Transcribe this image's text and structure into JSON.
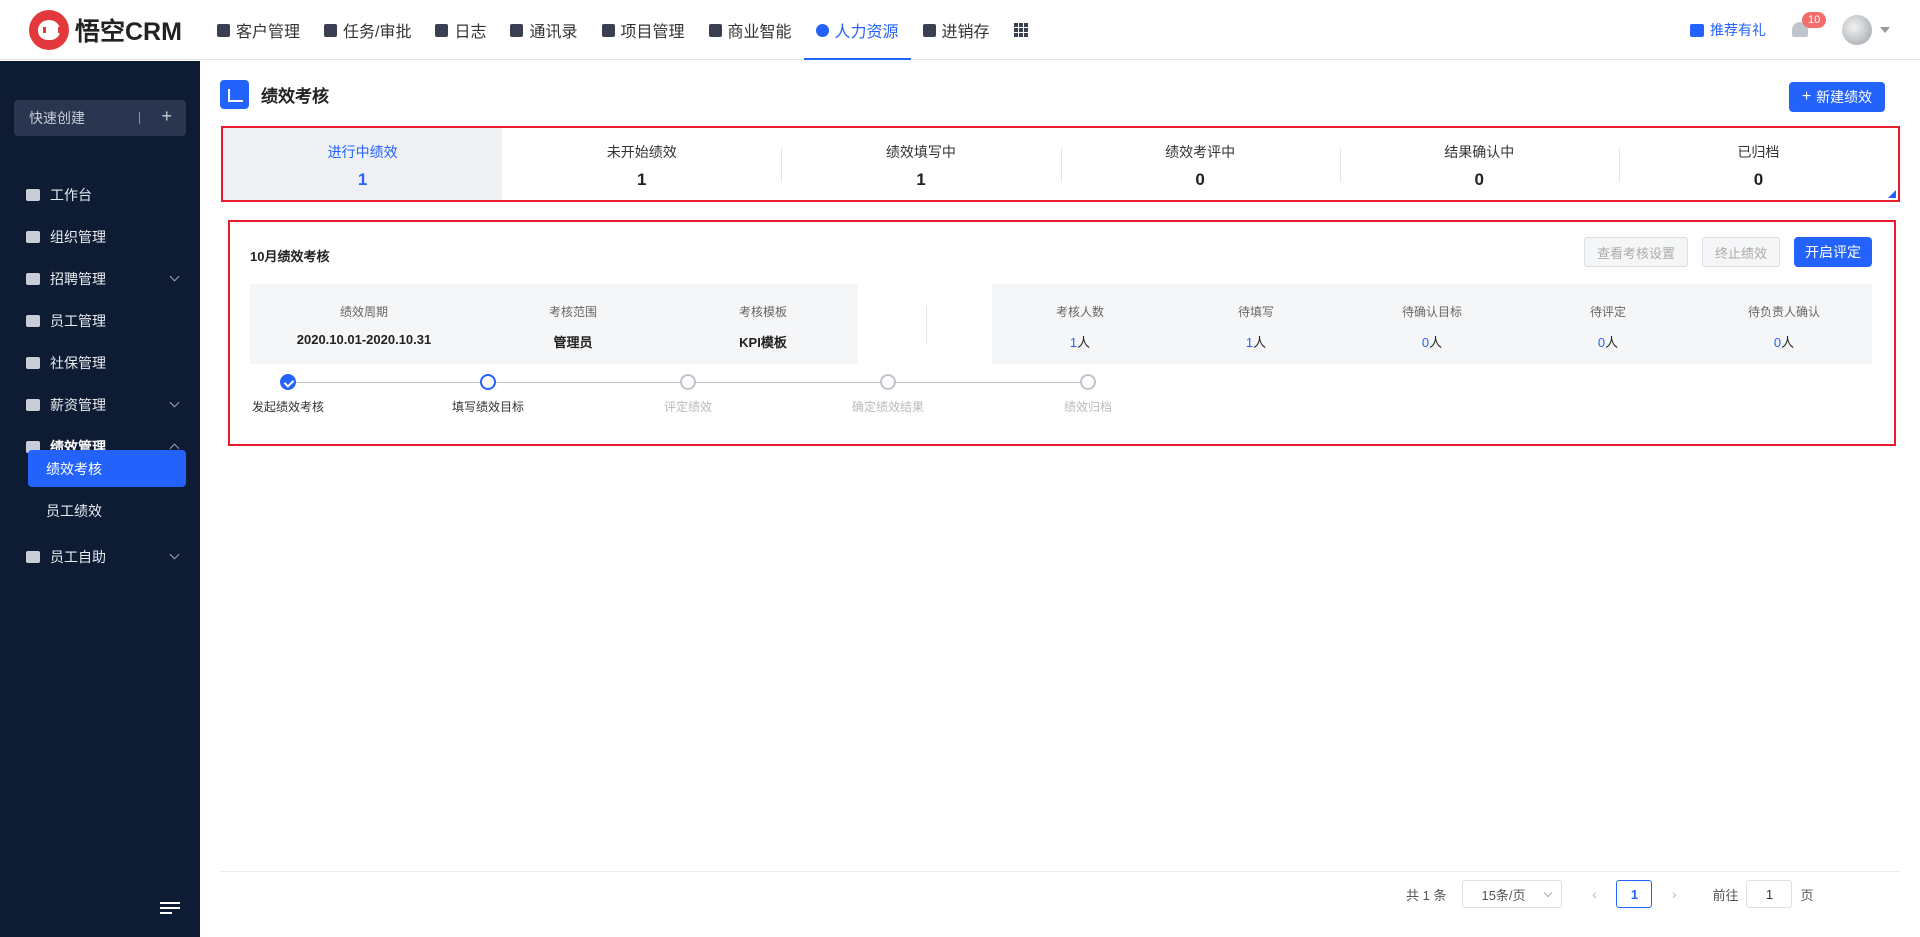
{
  "app": {
    "logo_text": "悟空CRM"
  },
  "nav": {
    "items": [
      {
        "label": "客户管理",
        "icon": "building-icon"
      },
      {
        "label": "任务/审批",
        "icon": "briefcase-icon"
      },
      {
        "label": "日志",
        "icon": "notebook-icon"
      },
      {
        "label": "通讯录",
        "icon": "phonebook-icon"
      },
      {
        "label": "项目管理",
        "icon": "list-icon"
      },
      {
        "label": "商业智能",
        "icon": "shield-icon"
      },
      {
        "label": "人力资源",
        "icon": "people-icon",
        "active": true
      },
      {
        "label": "进销存",
        "icon": "truck-icon"
      }
    ],
    "apps_icon": "grid-icon"
  },
  "header_right": {
    "gift_label": "推荐有礼",
    "notification_count": "10"
  },
  "sidebar": {
    "quick_create": "快速创建",
    "items": [
      {
        "label": "工作台"
      },
      {
        "label": "组织管理"
      },
      {
        "label": "招聘管理"
      },
      {
        "label": "员工管理"
      },
      {
        "label": "社保管理"
      },
      {
        "label": "薪资管理"
      },
      {
        "label": "绩效管理"
      },
      {
        "label": "员工自助"
      }
    ],
    "sub_items": [
      {
        "label": "绩效考核",
        "active": true
      },
      {
        "label": "员工绩效"
      }
    ]
  },
  "page": {
    "title": "绩效考核",
    "new_button": "新建绩效"
  },
  "tabs": [
    {
      "label": "进行中绩效",
      "count": "1",
      "active": true
    },
    {
      "label": "未开始绩效",
      "count": "1"
    },
    {
      "label": "绩效填写中",
      "count": "1"
    },
    {
      "label": "绩效考评中",
      "count": "0"
    },
    {
      "label": "结果确认中",
      "count": "0"
    },
    {
      "label": "已归档",
      "count": "0"
    }
  ],
  "card": {
    "title": "10月绩效考核",
    "btn_view_settings": "查看考核设置",
    "btn_stop": "终止绩效",
    "btn_start": "开启评定",
    "info_left": [
      {
        "label": "绩效周期",
        "value": "2020.10.01-2020.10.31"
      },
      {
        "label": "考核范围",
        "value": "管理员"
      },
      {
        "label": "考核模板",
        "value": "KPI模板"
      }
    ],
    "info_right": [
      {
        "label": "考核人数",
        "num": "1",
        "unit": "人"
      },
      {
        "label": "待填写",
        "num": "1",
        "unit": "人"
      },
      {
        "label": "待确认目标",
        "num": "0",
        "unit": "人"
      },
      {
        "label": "待评定",
        "num": "0",
        "unit": "人"
      },
      {
        "label": "待负责人确认",
        "num": "0",
        "unit": "人"
      }
    ],
    "steps": [
      {
        "label": "发起绩效考核",
        "state": "done"
      },
      {
        "label": "填写绩效目标",
        "state": "current"
      },
      {
        "label": "评定绩效",
        "state": "pending"
      },
      {
        "label": "确定绩效结果",
        "state": "pending"
      },
      {
        "label": "绩效归档",
        "state": "pending"
      }
    ]
  },
  "pagination": {
    "total": "共 1 条",
    "page_size": "15条/页",
    "prev": "‹",
    "current": "1",
    "next": "›",
    "goto_label": "前往",
    "goto_value": "1",
    "page_unit": "页"
  },
  "colors": {
    "primary": "#2362fb",
    "sidebar_bg": "#0d1b33",
    "highlight_border": "#e81b2e"
  }
}
